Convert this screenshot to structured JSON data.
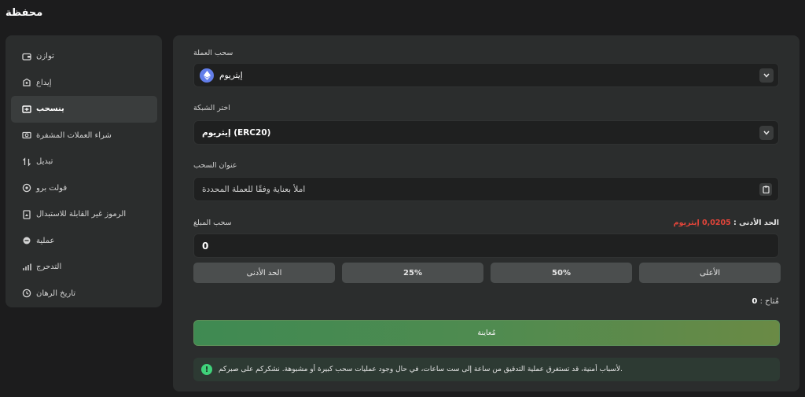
{
  "page_title": "محفظة",
  "sidebar": {
    "items": [
      {
        "label": "توازن",
        "icon": "wallet-icon"
      },
      {
        "label": "إيداع",
        "icon": "deposit-icon"
      },
      {
        "label": "ينسحب",
        "icon": "withdraw-icon",
        "active": true
      },
      {
        "label": "شراء العملات المشفرة",
        "icon": "buy-crypto-icon"
      },
      {
        "label": "تبديل",
        "icon": "swap-icon"
      },
      {
        "label": "فولت برو",
        "icon": "vault-icon"
      },
      {
        "label": "الرموز غير القابلة للاستبدال",
        "icon": "nft-icon"
      },
      {
        "label": "عملية",
        "icon": "transaction-icon"
      },
      {
        "label": "التدحرج",
        "icon": "rollover-icon"
      },
      {
        "label": "تاريخ الرهان",
        "icon": "history-icon"
      }
    ]
  },
  "form": {
    "currency_label": "سحب العملة",
    "currency_value": "إيثريوم",
    "network_label": "اختر الشبكة",
    "network_value": "إيثريوم (ERC20)",
    "address_label": "عنوان السحب",
    "address_placeholder": "املأ بعناية وفقًا للعملة المحددة",
    "amount_label": "سحب المبلغ",
    "min_label": "الحد الأدنى :",
    "min_value": "0,0205 إيثريوم",
    "amount_value": "0",
    "quick_buttons": [
      "الحد الأدنى",
      "25%",
      "50%",
      "الأعلى"
    ],
    "available_label": "مُتاح :",
    "available_value": "0",
    "preview_button": "مُعاينة",
    "notice": "لأسباب أمنية، قد تستغرق عملية التدقيق من ساعة إلى ست ساعات، في حال وجود عمليات سحب كبيرة أو مشبوهة. نشكركم على صبركم."
  },
  "colors": {
    "accent_green": "#4f8b50",
    "min_red": "#e4453a",
    "eth_blue": "#627eea"
  }
}
